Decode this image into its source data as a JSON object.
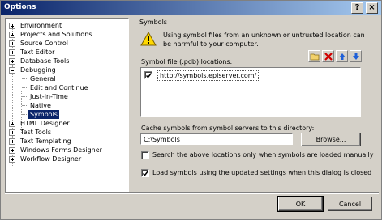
{
  "window": {
    "title": "Options"
  },
  "titlebar_buttons": {
    "help": "?",
    "close": "×"
  },
  "tree": [
    {
      "label": "Environment",
      "expander": "plus"
    },
    {
      "label": "Projects and Solutions",
      "expander": "plus"
    },
    {
      "label": "Source Control",
      "expander": "plus"
    },
    {
      "label": "Text Editor",
      "expander": "plus"
    },
    {
      "label": "Database Tools",
      "expander": "plus"
    },
    {
      "label": "Debugging",
      "expander": "minus"
    },
    {
      "label": "General",
      "child": true
    },
    {
      "label": "Edit and Continue",
      "child": true
    },
    {
      "label": "Just-In-Time",
      "child": true
    },
    {
      "label": "Native",
      "child": true
    },
    {
      "label": "Symbols",
      "child": true,
      "selected": true
    },
    {
      "label": "HTML Designer",
      "expander": "plus"
    },
    {
      "label": "Test Tools",
      "expander": "plus"
    },
    {
      "label": "Text Templating",
      "expander": "plus"
    },
    {
      "label": "Windows Forms Designer",
      "expander": "plus"
    },
    {
      "label": "Workflow Designer",
      "expander": "plus"
    }
  ],
  "panel": {
    "title": "Symbols",
    "warning": "Using symbol files from an unknown or untrusted location can be harmful to your computer.",
    "locations_label": "Symbol file (.pdb) locations:",
    "toolbar": {
      "icons": [
        "folder-icon",
        "delete-icon",
        "move-up-icon",
        "move-down-icon"
      ]
    },
    "locations": [
      {
        "text": "http://symbols.episerver.com/",
        "checked": true
      }
    ],
    "cache_label": "Cache symbols from symbol servers to this directory:",
    "cache_value": "C:\\Symbols",
    "browse_label": "Browse...",
    "option_search_manual": {
      "label": "Search the above locations only when symbols are loaded manually",
      "checked": false
    },
    "option_load_updated": {
      "label": "Load symbols using the updated settings when this dialog is closed",
      "checked": true
    }
  },
  "footer": {
    "ok_label": "OK",
    "cancel_label": "Cancel"
  },
  "colors": {
    "titlebar_start": "#0a246a",
    "titlebar_end": "#a6caf0",
    "selection": "#0a246a",
    "dialog_bg": "#d4d0c8"
  }
}
